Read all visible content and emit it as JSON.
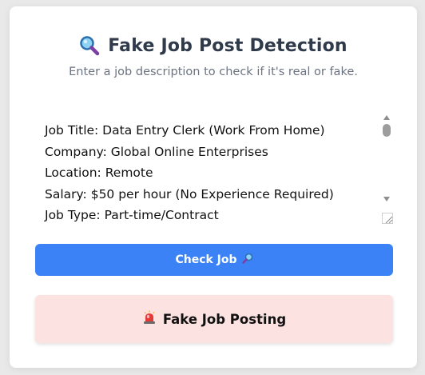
{
  "header": {
    "title": "Fake Job Post Detection",
    "subtitle": "Enter a job description to check if it's real or fake.",
    "title_icon": "magnifying-glass-icon"
  },
  "job_input": {
    "value": "Job Title: Data Entry Clerk (Work From Home)\nCompany: Global Online Enterprises\nLocation: Remote\nSalary: $50 per hour (No Experience Required)\nJob Type: Part-time/Contract"
  },
  "check_button": {
    "label": "Check Job",
    "icon": "magnifying-glass-icon",
    "color": "#3b82f6"
  },
  "result": {
    "label": "Fake Job Posting",
    "icon": "police-light-icon",
    "background": "#fde2e2"
  }
}
